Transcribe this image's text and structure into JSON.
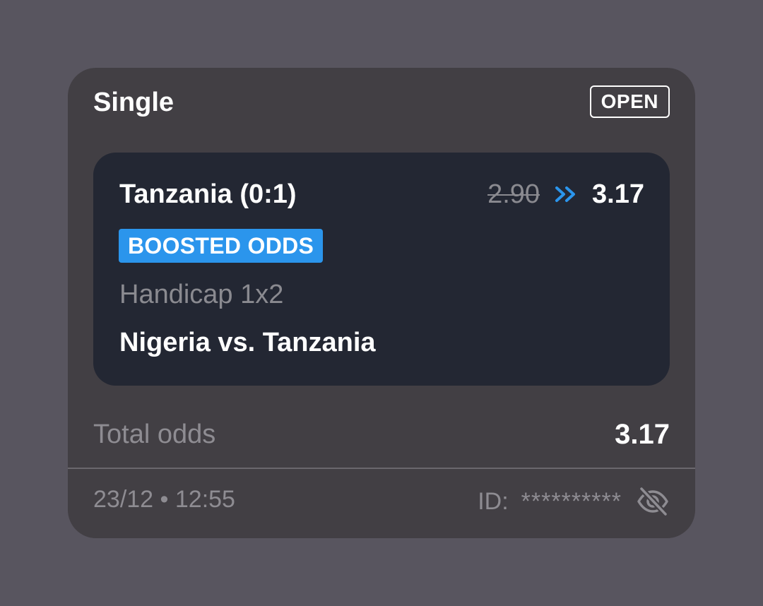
{
  "ticket": {
    "bet_type": "Single",
    "status": "OPEN"
  },
  "selection": {
    "name": "Tanzania (0:1)",
    "old_odds": "2.90",
    "new_odds": "3.17",
    "boost_label": "BOOSTED ODDS",
    "market": "Handicap 1x2",
    "event": "Nigeria vs. Tanzania"
  },
  "summary": {
    "total_label": "Total odds",
    "total_value": "3.17"
  },
  "footer": {
    "datetime": "23/12 • 12:55",
    "id_label": "ID:",
    "id_value": "**********"
  },
  "colors": {
    "page_bg": "#58555f",
    "card_bg": "#423f44",
    "selection_bg": "#232733",
    "accent_blue": "#2b95ec",
    "muted_text": "#8e8c92"
  },
  "icons": {
    "odds_change": "double-chevron-right-icon",
    "visibility": "eye-off-icon"
  }
}
